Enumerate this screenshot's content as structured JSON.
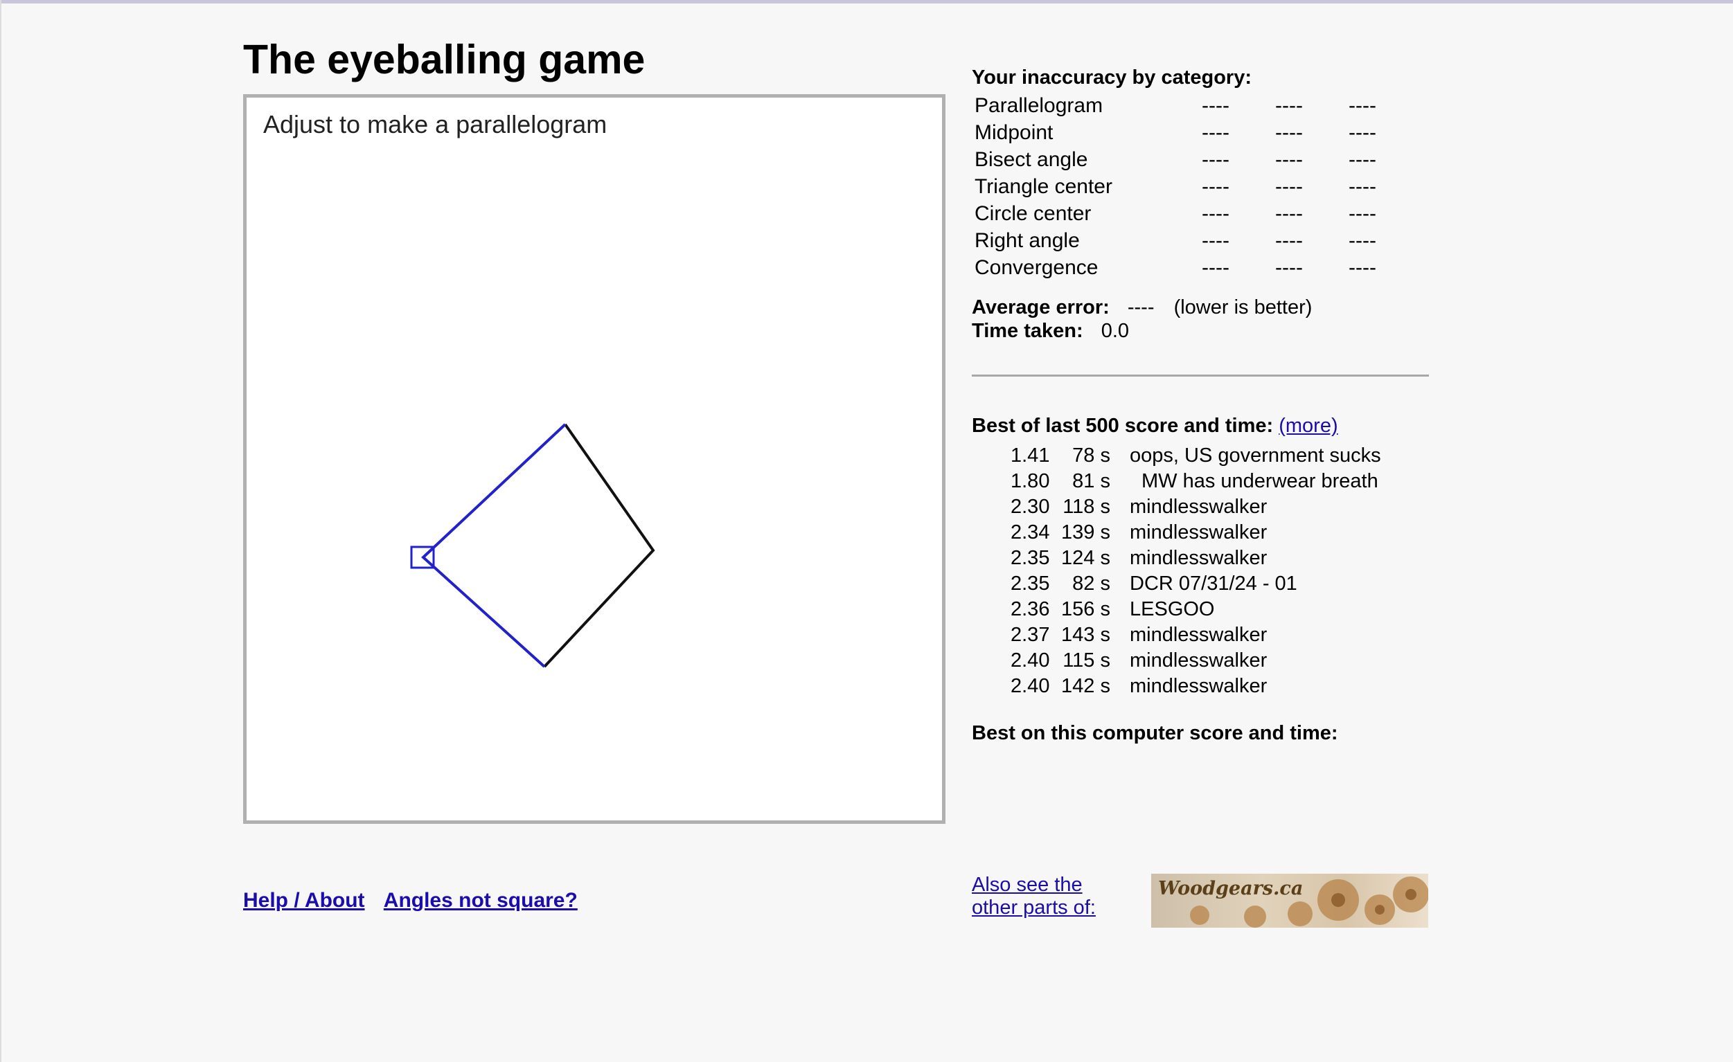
{
  "page": {
    "title": "The eyeballing game"
  },
  "game": {
    "prompt": "Adjust to make a parallelogram"
  },
  "inaccuracy": {
    "heading": "Your inaccuracy by category:",
    "categories": [
      {
        "name": "Parallelogram",
        "v1": "----",
        "v2": "----",
        "v3": "----"
      },
      {
        "name": "Midpoint",
        "v1": "----",
        "v2": "----",
        "v3": "----"
      },
      {
        "name": "Bisect angle",
        "v1": "----",
        "v2": "----",
        "v3": "----"
      },
      {
        "name": "Triangle center",
        "v1": "----",
        "v2": "----",
        "v3": "----"
      },
      {
        "name": "Circle center",
        "v1": "----",
        "v2": "----",
        "v3": "----"
      },
      {
        "name": "Right angle",
        "v1": "----",
        "v2": "----",
        "v3": "----"
      },
      {
        "name": "Convergence",
        "v1": "----",
        "v2": "----",
        "v3": "----"
      }
    ],
    "average_label": "Average error:",
    "average_value": "----",
    "average_note": "(lower is better)",
    "time_label": "Time taken:",
    "time_value": "0.0"
  },
  "best": {
    "heading": "Best of last 500 score and time:",
    "more_link": "(more)",
    "scores": [
      {
        "score": "1.41",
        "time": "78 s",
        "name": "oops, US government sucks"
      },
      {
        "score": "1.80",
        "time": "81 s",
        "name": "MW has underwear breath"
      },
      {
        "score": "2.30",
        "time": "118 s",
        "name": "mindlesswalker"
      },
      {
        "score": "2.34",
        "time": "139 s",
        "name": "mindlesswalker"
      },
      {
        "score": "2.35",
        "time": "124 s",
        "name": "mindlesswalker"
      },
      {
        "score": "2.35",
        "time": "82 s",
        "name": "DCR 07/31/24 - 01"
      },
      {
        "score": "2.36",
        "time": "156 s",
        "name": "LESGOO"
      },
      {
        "score": "2.37",
        "time": "143 s",
        "name": "mindlesswalker"
      },
      {
        "score": "2.40",
        "time": "115 s",
        "name": "mindlesswalker"
      },
      {
        "score": "2.40",
        "time": "142 s",
        "name": "mindlesswalker"
      }
    ],
    "computer_heading": "Best on this computer score and time:"
  },
  "footer": {
    "help_link": "Help / About",
    "angles_link": "Angles not square?",
    "also_line1": "Also see the",
    "also_line2": "other parts of:",
    "banner_text": "Woodgears.ca"
  },
  "colors": {
    "handle_blue": "#2222cc",
    "link": "#1a0dab",
    "canvas_border": "#b0b0b0"
  }
}
